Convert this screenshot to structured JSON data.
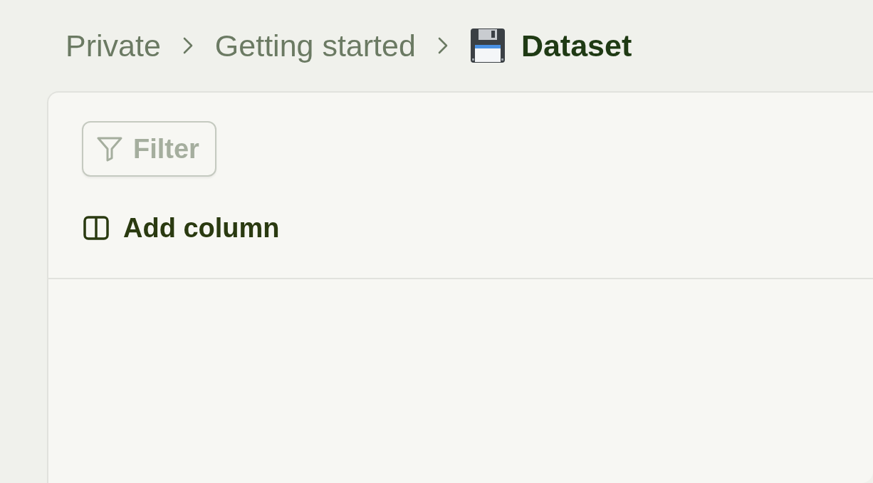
{
  "breadcrumb": [
    {
      "label": "Private",
      "current": false
    },
    {
      "label": "Getting started",
      "current": false
    },
    {
      "label": "Dataset",
      "current": true
    }
  ],
  "toolbar": {
    "filter_button": {
      "label": "Filter",
      "disabled": true
    }
  },
  "table": {
    "add_column_button": {
      "label": "Add column"
    }
  }
}
